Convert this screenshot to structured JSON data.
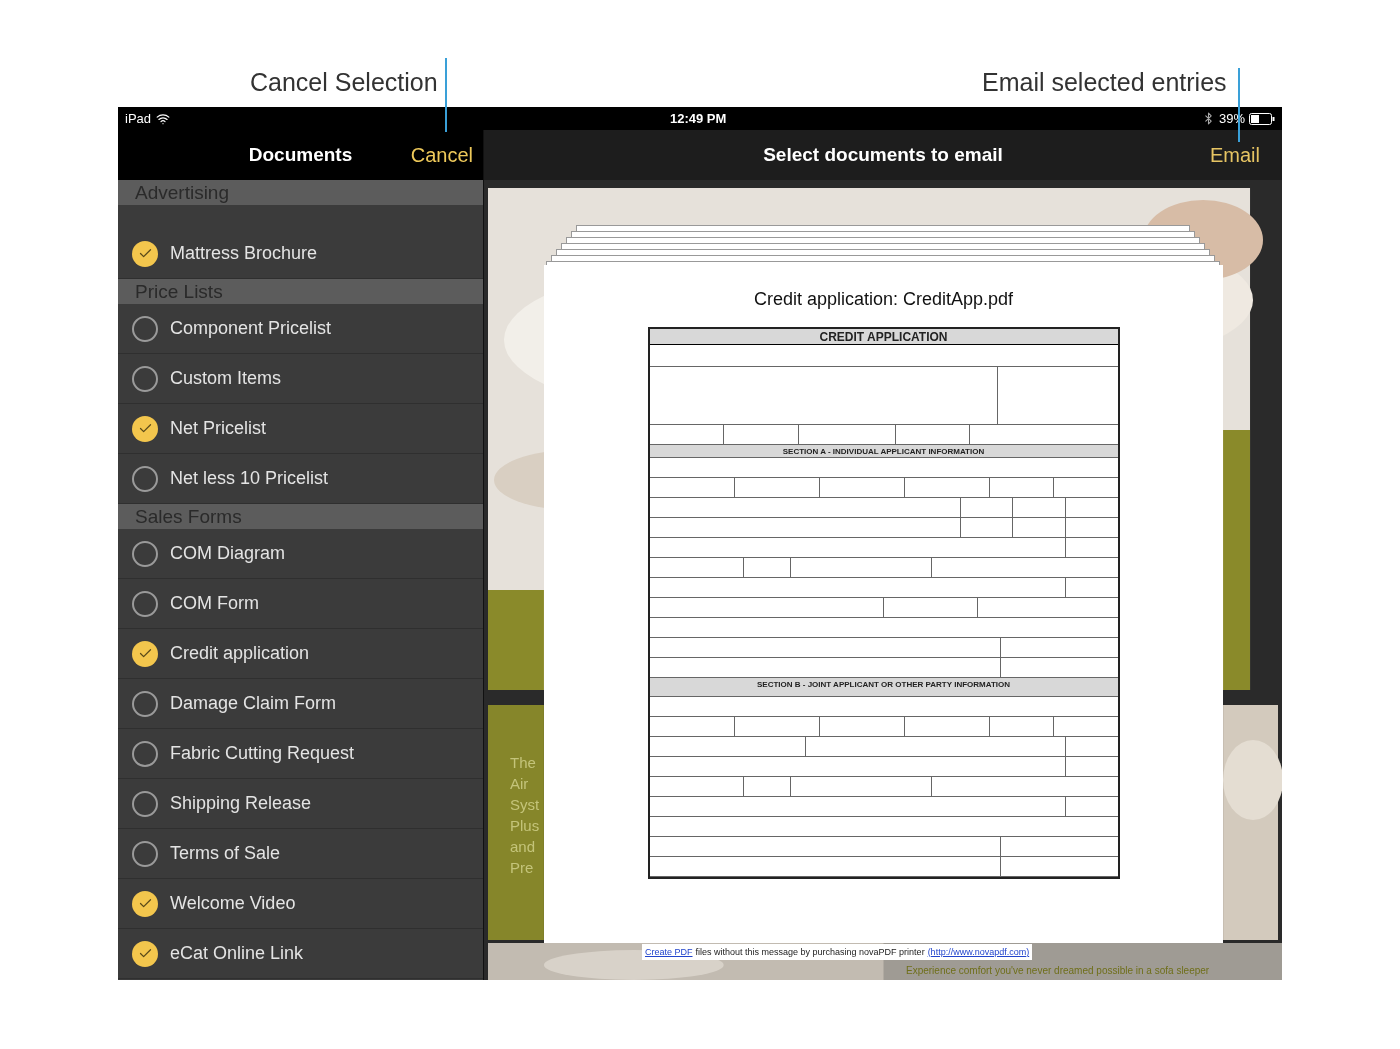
{
  "annotations": [
    {
      "text": "Cancel Selection",
      "kind": "left"
    },
    {
      "text": "Email selected entries",
      "kind": "right"
    }
  ],
  "status_bar": {
    "device": "iPad",
    "time": "12:49 PM",
    "battery": "39%"
  },
  "sidebar": {
    "title": "Documents",
    "cancel": "Cancel",
    "sections": [
      {
        "title": "Advertising",
        "items": [
          {
            "label": "Mattress Brochure",
            "checked": true
          }
        ]
      },
      {
        "title": "Price Lists",
        "items": [
          {
            "label": "Component Pricelist",
            "checked": false
          },
          {
            "label": "Custom Items",
            "checked": false
          },
          {
            "label": "Net Pricelist",
            "checked": true
          },
          {
            "label": "Net less 10 Pricelist",
            "checked": false
          }
        ]
      },
      {
        "title": "Sales Forms",
        "items": [
          {
            "label": "COM Diagram",
            "checked": false
          },
          {
            "label": "COM Form",
            "checked": false
          },
          {
            "label": "Credit application",
            "checked": true
          },
          {
            "label": "Damage Claim Form",
            "checked": false
          },
          {
            "label": "Fabric Cutting Request",
            "checked": false
          },
          {
            "label": "Shipping Release",
            "checked": false
          },
          {
            "label": "Terms of Sale",
            "checked": false
          },
          {
            "label": "Welcome Video",
            "checked": true
          },
          {
            "label": "eCat Online Link",
            "checked": true
          }
        ]
      }
    ]
  },
  "main": {
    "title": "Select documents to email",
    "email": "Email",
    "brochure_fragments": [
      "The",
      "Air",
      "Syst",
      "Plus",
      "and",
      "Pre"
    ],
    "brochure_tagline": "Experience comfort you've never dreamed possible in a sofa sleeper",
    "preview": {
      "title": "Credit application: CreditApp.pdf",
      "form_title": "CREDIT APPLICATION",
      "section_headings": [
        "SECTION A - INDIVIDUAL APPLICANT INFORMATION",
        "SECTION B - JOINT APPLICANT OR OTHER PARTY INFORMATION"
      ]
    },
    "pdf_notice": {
      "link": "Create PDF",
      "text": "files without this message by purchasing novaPDF printer",
      "url": "(http://www.novapdf.com)"
    }
  }
}
